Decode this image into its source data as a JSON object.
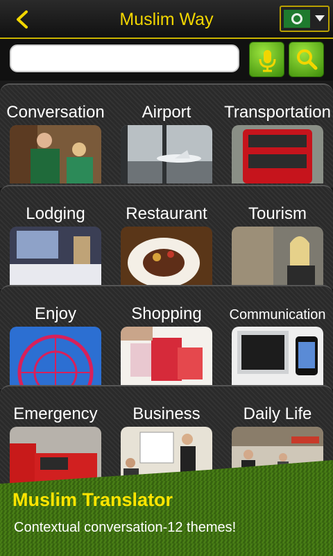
{
  "header": {
    "title": "Muslim Way",
    "back_icon": "chevron-left-icon",
    "accent_color": "#f2d600"
  },
  "search": {
    "value": "",
    "placeholder": ""
  },
  "themes": [
    {
      "label": "Conversation"
    },
    {
      "label": "Airport"
    },
    {
      "label": "Transportation"
    },
    {
      "label": "Lodging"
    },
    {
      "label": "Restaurant"
    },
    {
      "label": "Tourism"
    },
    {
      "label": "Enjoy"
    },
    {
      "label": "Shopping"
    },
    {
      "label": "Communication"
    },
    {
      "label": "Emergency"
    },
    {
      "label": "Business"
    },
    {
      "label": "Daily Life"
    }
  ],
  "banner": {
    "title": "Muslim Translator",
    "subtitle": "Contextual conversation-12 themes!"
  }
}
